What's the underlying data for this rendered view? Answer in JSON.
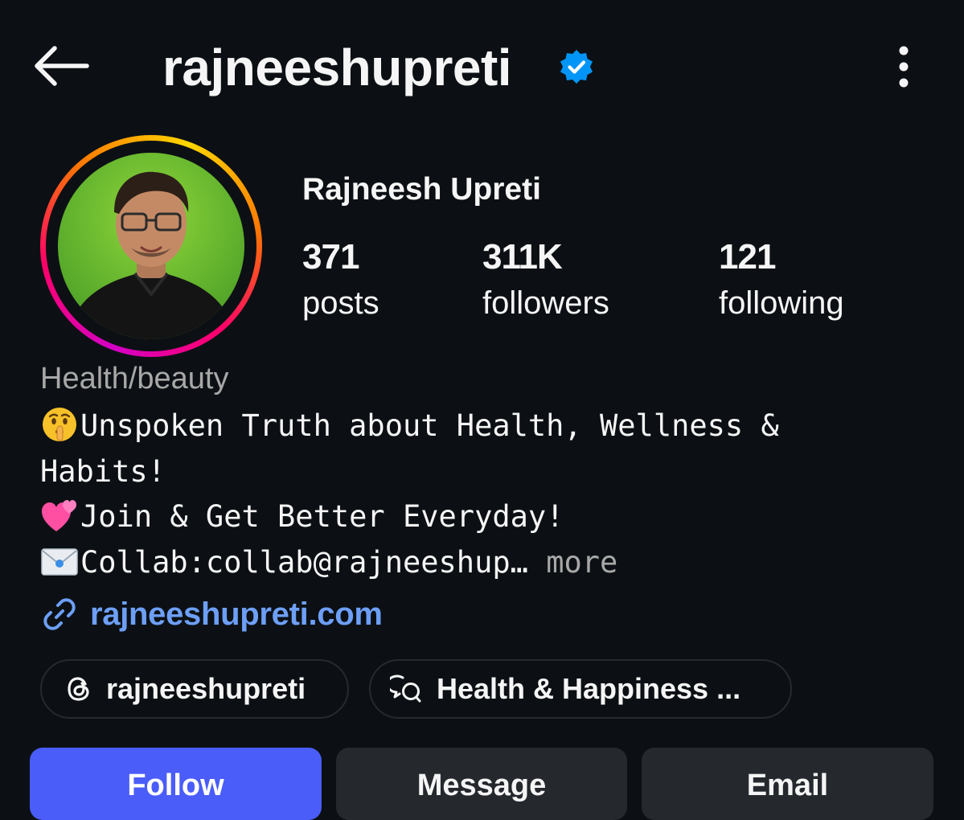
{
  "header": {
    "username": "rajneeshupreti",
    "verified": true
  },
  "profile": {
    "display_name": "Rajneesh Upreti",
    "avatar_icon": "profile-photo"
  },
  "stats": [
    {
      "value": "371",
      "label": "posts"
    },
    {
      "value": "311K",
      "label": "followers"
    },
    {
      "value": "121",
      "label": "following"
    }
  ],
  "category": "Health/beauty",
  "bio": {
    "line1": "Unspoken Truth about Health, Wellness &",
    "line2": "Habits!",
    "line3": "Join & Get Better Everyday!",
    "line4": "Collab:collab@rajneeshup…",
    "more": "more"
  },
  "link": {
    "text": "rajneeshupreti.com"
  },
  "chips": [
    {
      "label": "rajneeshupreti",
      "icon": "threads-icon"
    },
    {
      "label": "Health & Happiness ...",
      "icon": "channel-icon"
    }
  ],
  "actions": {
    "follow": "Follow",
    "message": "Message",
    "email": "Email"
  },
  "colors": {
    "background": "#0c1014",
    "follow_button": "#4a5df9",
    "secondary_button": "#25292e",
    "link": "#6d9ff7",
    "verified": "#0095f6",
    "muted_text": "#a8a8a8"
  }
}
